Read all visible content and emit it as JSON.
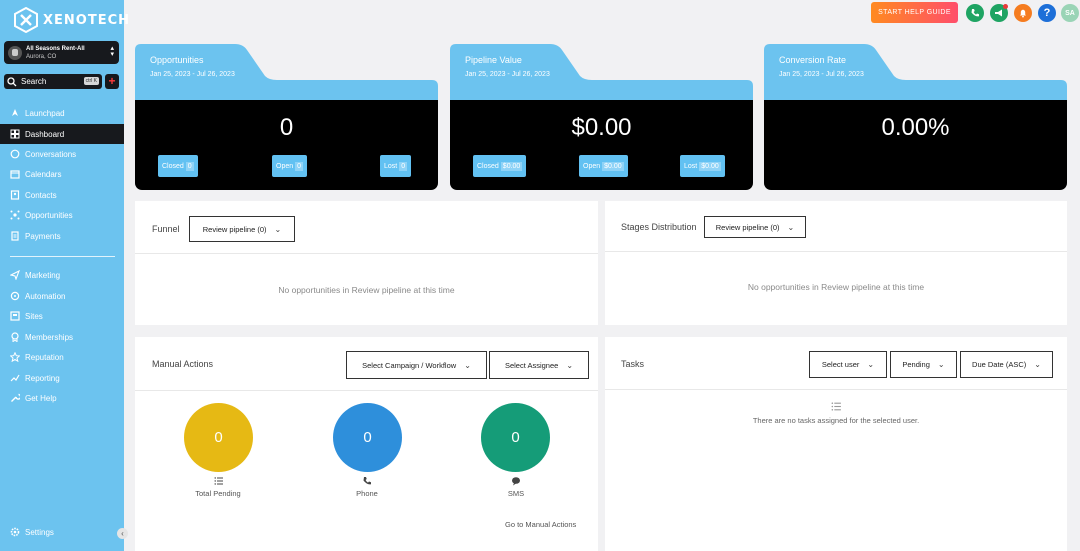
{
  "brand": {
    "name": "XENOTECH"
  },
  "account": {
    "name": "All Seasons Rent-All",
    "location": "Aurora, CO"
  },
  "search": {
    "label": "Search",
    "shortcut": "ctrl K"
  },
  "sidebar": {
    "items": [
      {
        "label": "Launchpad",
        "icon": "rocket-icon"
      },
      {
        "label": "Dashboard",
        "icon": "dashboard-icon"
      },
      {
        "label": "Conversations",
        "icon": "chat-icon"
      },
      {
        "label": "Calendars",
        "icon": "calendar-icon"
      },
      {
        "label": "Contacts",
        "icon": "contacts-icon"
      },
      {
        "label": "Opportunities",
        "icon": "opportunities-icon"
      },
      {
        "label": "Payments",
        "icon": "payments-icon"
      },
      {
        "label": "Marketing",
        "icon": "send-icon"
      },
      {
        "label": "Automation",
        "icon": "automation-icon"
      },
      {
        "label": "Sites",
        "icon": "sites-icon"
      },
      {
        "label": "Memberships",
        "icon": "membership-icon"
      },
      {
        "label": "Reputation",
        "icon": "star-icon"
      },
      {
        "label": "Reporting",
        "icon": "trend-icon"
      },
      {
        "label": "Get Help",
        "icon": "wrench-icon"
      }
    ],
    "settings": "Settings",
    "active": "Dashboard"
  },
  "header": {
    "help_guide": "START HELP GUIDE",
    "avatar_initials": "SA"
  },
  "stats": [
    {
      "title": "Opportunities",
      "date": "Jan 25, 2023 - Jul 26, 2023",
      "value": "0",
      "pills": [
        {
          "label": "Closed",
          "value": "0"
        },
        {
          "label": "Open",
          "value": "0"
        },
        {
          "label": "Lost",
          "value": "0"
        }
      ]
    },
    {
      "title": "Pipeline Value",
      "date": "Jan 25, 2023 - Jul 26, 2023",
      "value": "$0.00",
      "pills": [
        {
          "label": "Closed",
          "value": "$0.00"
        },
        {
          "label": "Open",
          "value": "$0.00"
        },
        {
          "label": "Lost",
          "value": "$0.00"
        }
      ]
    },
    {
      "title": "Conversion Rate",
      "date": "Jan 25, 2023 - Jul 26, 2023",
      "value": "0.00%"
    }
  ],
  "funnel": {
    "title": "Funnel",
    "pipeline": "Review pipeline (0)",
    "empty": "No opportunities in Review pipeline at this time"
  },
  "stages": {
    "title": "Stages Distribution",
    "pipeline": "Review pipeline (0)",
    "empty": "No opportunities in Review pipeline at this time"
  },
  "manual_actions": {
    "title": "Manual Actions",
    "campaign_select": "Select Campaign / Workflow",
    "assignee_select": "Select Assignee",
    "total_pending": {
      "value": "0",
      "label": "Total Pending"
    },
    "phone": {
      "value": "0",
      "label": "Phone"
    },
    "sms": {
      "value": "0",
      "label": "SMS"
    },
    "link": "Go to Manual Actions"
  },
  "tasks": {
    "title": "Tasks",
    "user_select": "Select user",
    "status_select": "Pending",
    "sort_select": "Due Date (ASC)",
    "empty": "There are no tasks assigned for the selected user."
  },
  "colors": {
    "sidebar": "#6cc3ef",
    "tab_blue": "#6cc3ef",
    "pending_yellow": "#e6b914",
    "phone_blue": "#2e8fdb",
    "sms_green": "#159c78"
  }
}
